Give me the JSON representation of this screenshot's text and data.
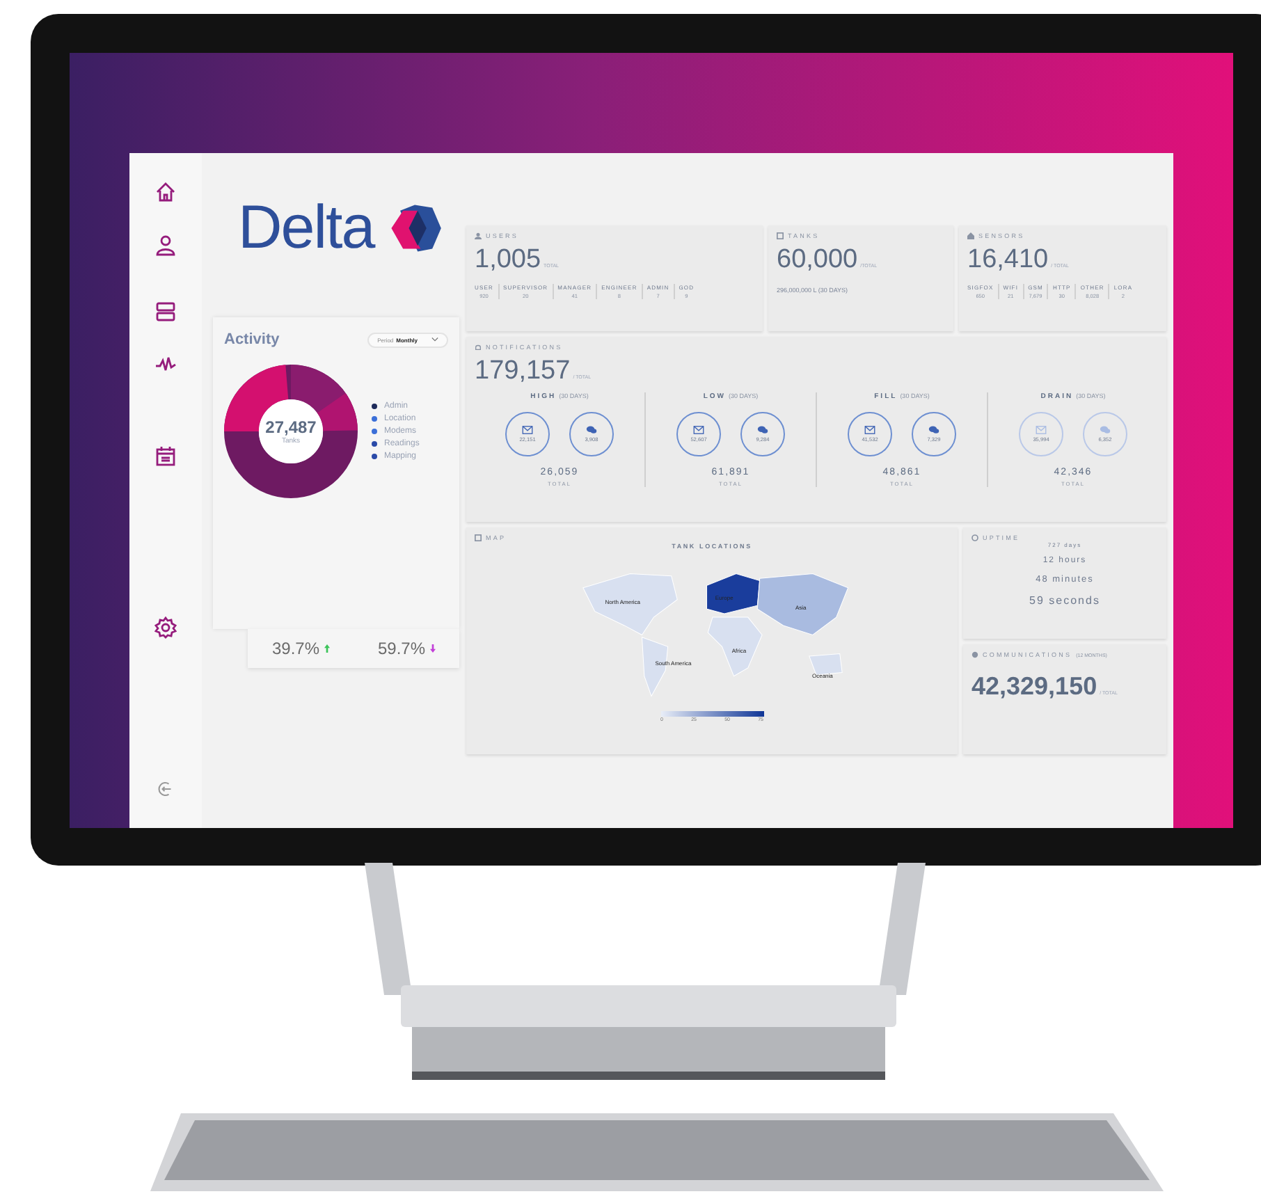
{
  "brand": {
    "name": "Delta"
  },
  "activity": {
    "title": "Activity",
    "period_label": "Period",
    "period_value": "Monthly",
    "total": "27,487",
    "total_label": "Tanks",
    "legend": [
      {
        "label": "Admin",
        "color": "#1e2a5a"
      },
      {
        "label": "Location",
        "color": "#3b6fd8"
      },
      {
        "label": "Modems",
        "color": "#3b6fd8"
      },
      {
        "label": "Readings",
        "color": "#2a4aa8"
      },
      {
        "label": "Mapping",
        "color": "#2a4aa8"
      }
    ]
  },
  "stats": [
    {
      "value": "39.7%",
      "kind": "up"
    },
    {
      "value": "59.7%",
      "kind": "down"
    }
  ],
  "users": {
    "title": "USERS",
    "value": "1,005",
    "unit": "TOTAL",
    "breakdown": [
      {
        "label": "USER",
        "value": "920"
      },
      {
        "label": "SUPERVISOR",
        "value": "20"
      },
      {
        "label": "MANAGER",
        "value": "41"
      },
      {
        "label": "ENGINEER",
        "value": "8"
      },
      {
        "label": "ADMIN",
        "value": "7"
      },
      {
        "label": "GOD",
        "value": "9"
      }
    ]
  },
  "tanks": {
    "title": "TANKS",
    "value": "60,000",
    "unit": "/TOTAL",
    "note": "296,000,000 L (30 DAYS)"
  },
  "sensors": {
    "title": "SENSORS",
    "value": "16,410",
    "unit": "/ TOTAL",
    "breakdown": [
      {
        "label": "SIGFOX",
        "value": "650"
      },
      {
        "label": "WIFI",
        "value": "21"
      },
      {
        "label": "GSM",
        "value": "7,679"
      },
      {
        "label": "HTTP",
        "value": "30"
      },
      {
        "label": "OTHER",
        "value": "8,028"
      },
      {
        "label": "LORA",
        "value": "2"
      }
    ]
  },
  "notifications": {
    "title": "NOTIFICATIONS",
    "value": "179,157",
    "unit": "/ TOTAL",
    "groups": [
      {
        "name": "HIGH",
        "period": "(30 DAYS)",
        "email": "22,151",
        "sms": "3,908",
        "total": "26,059",
        "total_label": "TOTAL",
        "muted": false
      },
      {
        "name": "LOW",
        "period": "(30 DAYS)",
        "email": "52,607",
        "sms": "9,284",
        "total": "61,891",
        "total_label": "TOTAL",
        "muted": false
      },
      {
        "name": "FILL",
        "period": "(30 DAYS)",
        "email": "41,532",
        "sms": "7,329",
        "total": "48,861",
        "total_label": "TOTAL",
        "muted": false
      },
      {
        "name": "DRAIN",
        "period": "(30 DAYS)",
        "email": "35,994",
        "sms": "6,352",
        "total": "42,346",
        "total_label": "TOTAL",
        "muted": true
      }
    ]
  },
  "map": {
    "title": "MAP",
    "chart_title": "TANK LOCATIONS",
    "regions": [
      "North America",
      "Europe",
      "Asia",
      "Africa",
      "South America",
      "Oceania"
    ],
    "scale_ticks": [
      "0",
      "25",
      "50",
      "75"
    ]
  },
  "uptime": {
    "title": "UPTIME",
    "lines": [
      "727 days",
      "12 hours",
      "48 minutes",
      "59 seconds"
    ]
  },
  "communications": {
    "title": "COMMUNICATIONS",
    "qualifier": "(12 MONTHS)",
    "value": "42,329,150",
    "unit": "/ TOTAL"
  }
}
